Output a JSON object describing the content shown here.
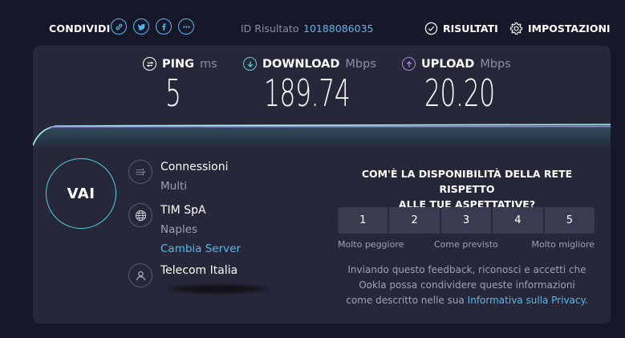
{
  "topbar": {
    "share_label": "CONDIVIDI",
    "share_icons": [
      "link-icon",
      "twitter-icon",
      "facebook-icon",
      "more-icon"
    ],
    "result_id_label": "ID Risultato",
    "result_id_value": "10188086035",
    "results_label": "RISULTATI",
    "settings_label": "IMPOSTAZIONI"
  },
  "metrics": {
    "ping": {
      "name": "PING",
      "unit": "ms",
      "value": "5",
      "icon": "ping-icon",
      "color": "#ffffff"
    },
    "download": {
      "name": "DOWNLOAD",
      "unit": "Mbps",
      "value": "189.74",
      "icon": "download-arrow-icon",
      "color": "#4fd1de"
    },
    "upload": {
      "name": "UPLOAD",
      "unit": "Mbps",
      "value": "20.20",
      "icon": "upload-arrow-icon",
      "color": "#b07ef0"
    }
  },
  "go_label": "VAI",
  "server": {
    "connections_title": "Connessioni",
    "connections_value": "Multi",
    "host_name": "TIM SpA",
    "host_location": "Naples",
    "change_server": "Cambia Server",
    "provider_name": "Telecom Italia"
  },
  "feedback": {
    "question_line1": "COM'È LA DISPONIBILITÀ DELLA RETE RISPETTO",
    "question_line2": "ALLE TUE ASPETTATIVE?",
    "ratings": [
      "1",
      "2",
      "3",
      "4",
      "5"
    ],
    "label_worse": "Molto peggiore",
    "label_expected": "Come previsto",
    "label_better": "Molto migliore",
    "disclaimer_1": "Inviando questo feedback, riconosci e accetti che",
    "disclaimer_2": "Ookla possa condividere queste informazioni",
    "disclaimer_3": "come descritto nelle sua",
    "privacy_link": "Informativa sulla Privacy",
    "disclaimer_end": "."
  },
  "colors": {
    "background": "#161728",
    "panel": "#262839",
    "accent_blue": "#54b9f2",
    "download_cyan": "#4fd1de",
    "upload_purple": "#b07ef0"
  }
}
